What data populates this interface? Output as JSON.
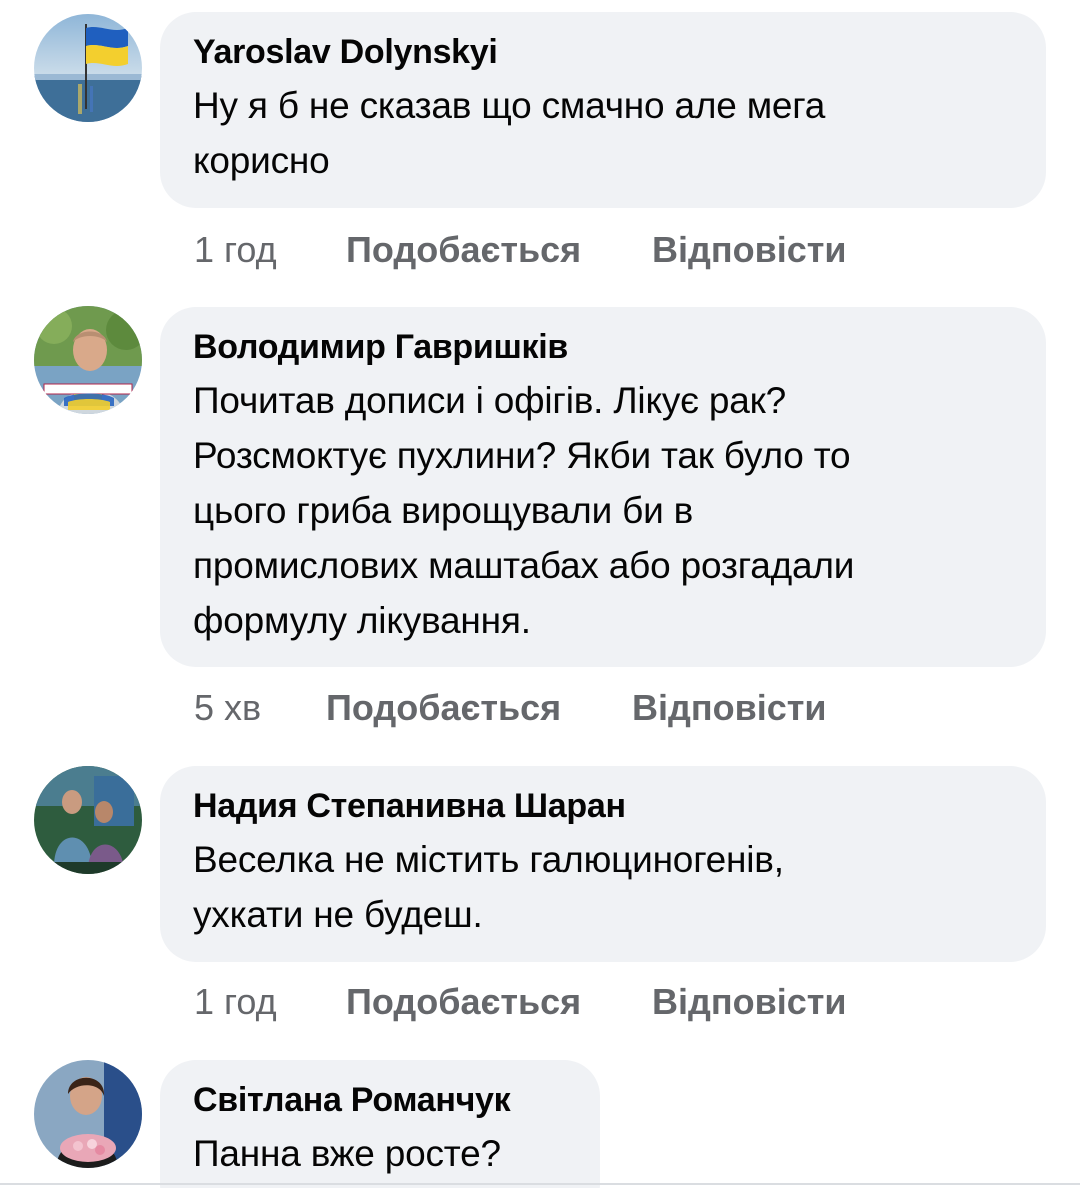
{
  "comments": [
    {
      "author": "Yaroslav Dolynskyi",
      "text": "Ну я б не сказав що смачно але мега\nкорисно",
      "time": "1 год",
      "like_label": "Подобається",
      "reply_label": "Відповісти"
    },
    {
      "author": "Володимир Гавришків",
      "text": "Почитав дописи і офігів. Лікує рак?\nРозсмоктує пухлини? Якби так було то\nцього гриба вирощували би в\nпромислових  маштабах або розгадали\nформулу лікування.",
      "time": "5 хв",
      "like_label": "Подобається",
      "reply_label": "Відповісти"
    },
    {
      "author": "Надия Степанивна Шаран",
      "text": "Веселка не містить галюциногенів,\nухкати не будеш.",
      "time": "1 год",
      "like_label": "Подобається",
      "reply_label": "Відповісти"
    },
    {
      "author": "Світлана Романчук",
      "text": "Панна вже росте?"
    }
  ],
  "colors": {
    "bubble_bg": "#f0f2f5",
    "text": "#050505",
    "secondary_text": "#65676b"
  }
}
